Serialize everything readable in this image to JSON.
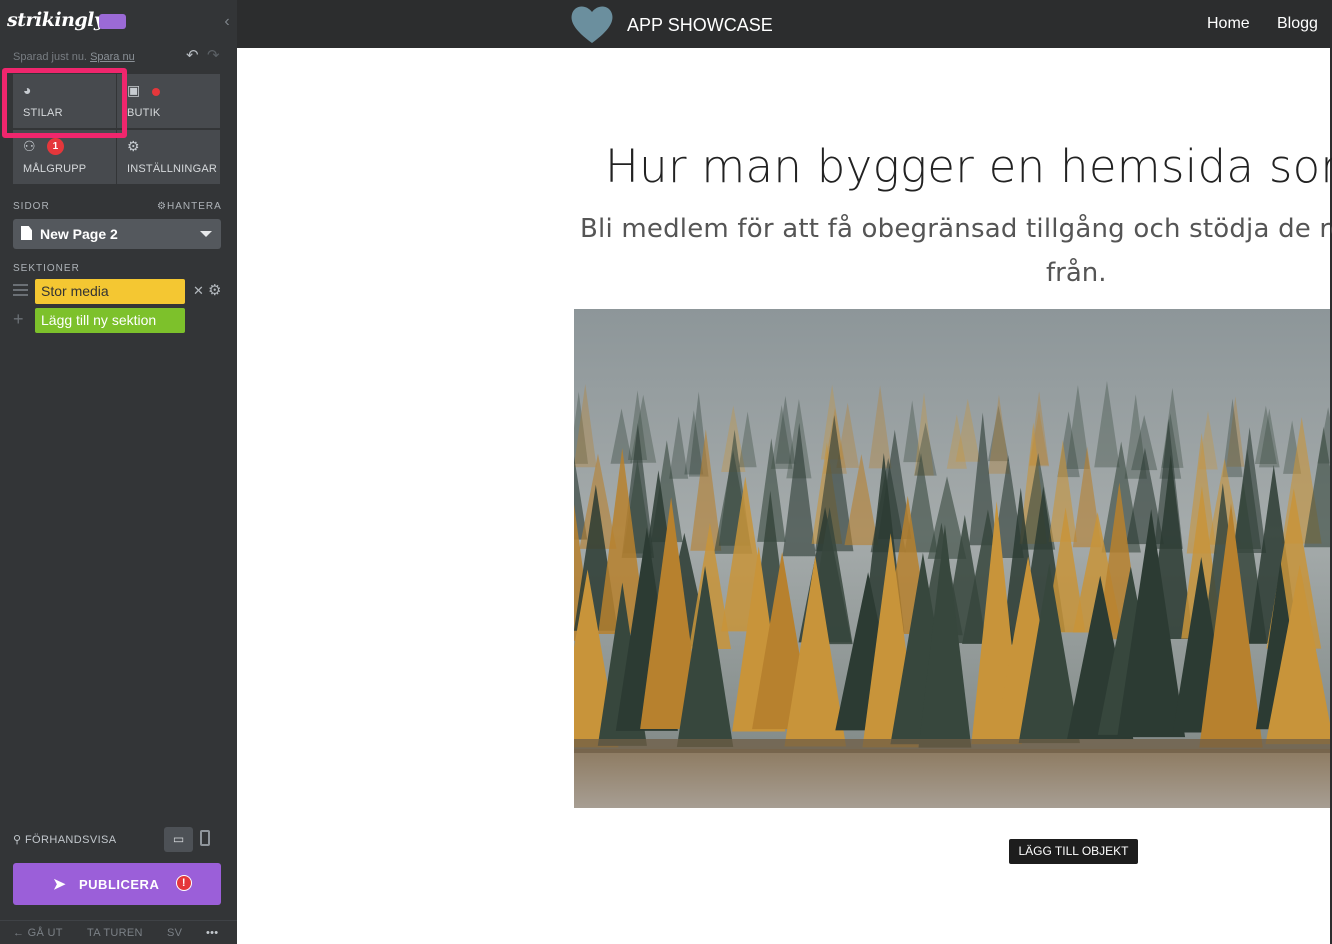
{
  "sidebar": {
    "logo": "strikingly",
    "saved_text": "Sparad just nu.",
    "save_now": "Spara nu",
    "tiles": {
      "styles": "STILAR",
      "store": "BUTIK",
      "audience": "MÅLGRUPP",
      "audience_badge": "1",
      "settings": "INSTÄLLNINGAR"
    },
    "pages_label": "SIDOR",
    "manage_label": "HANTERA",
    "current_page": "New Page 2",
    "sections_label": "SEKTIONER",
    "sections": [
      {
        "label": "Stor media",
        "color": "#f4c732"
      }
    ],
    "add_section": "Lägg till ny sektion",
    "preview_label": "FÖRHANDSVISA",
    "publish_label": "PUBLICERA",
    "publish_alert": "!",
    "footer": {
      "exit": "GÅ UT",
      "tour": "TA TUREN",
      "lang": "SV",
      "more": "•••"
    }
  },
  "site": {
    "brand": "APP SHOWCASE",
    "nav": [
      "Home",
      "Blogg"
    ],
    "headline": "Hur man bygger en hemsida som",
    "subheadline_line1": "Bli medlem för att få obegränsad tillgång och stödja de röst",
    "subheadline_line2": "från.",
    "add_object": "LÄGG TILL OBJEKT"
  },
  "colors": {
    "sidebar_bg": "#333537",
    "highlight": "#f0266d",
    "publish": "#9b5fd9",
    "section_yellow": "#f4c732",
    "section_green": "#7dc12b"
  }
}
